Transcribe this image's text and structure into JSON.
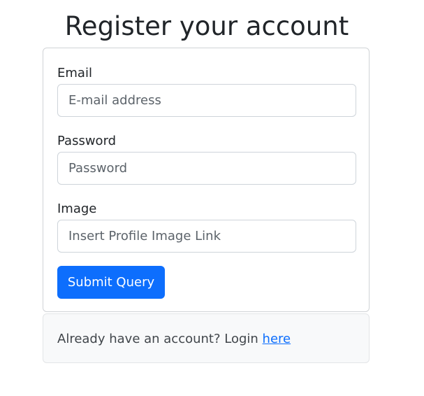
{
  "header": {
    "title": "Register your account"
  },
  "form": {
    "email_label": "Email",
    "email_placeholder": "E-mail address",
    "email_value": "",
    "password_label": "Password",
    "password_placeholder": "Password",
    "password_value": "",
    "image_label": "Image",
    "image_placeholder": "Insert Profile Image Link",
    "image_value": "",
    "submit_label": "Submit Query"
  },
  "footer": {
    "prompt_text": "Already have an account? Login ",
    "link_text": "here"
  },
  "colors": {
    "primary": "#0d6efd",
    "footer_background": "#f8f9fa",
    "border": "#ced4da"
  }
}
